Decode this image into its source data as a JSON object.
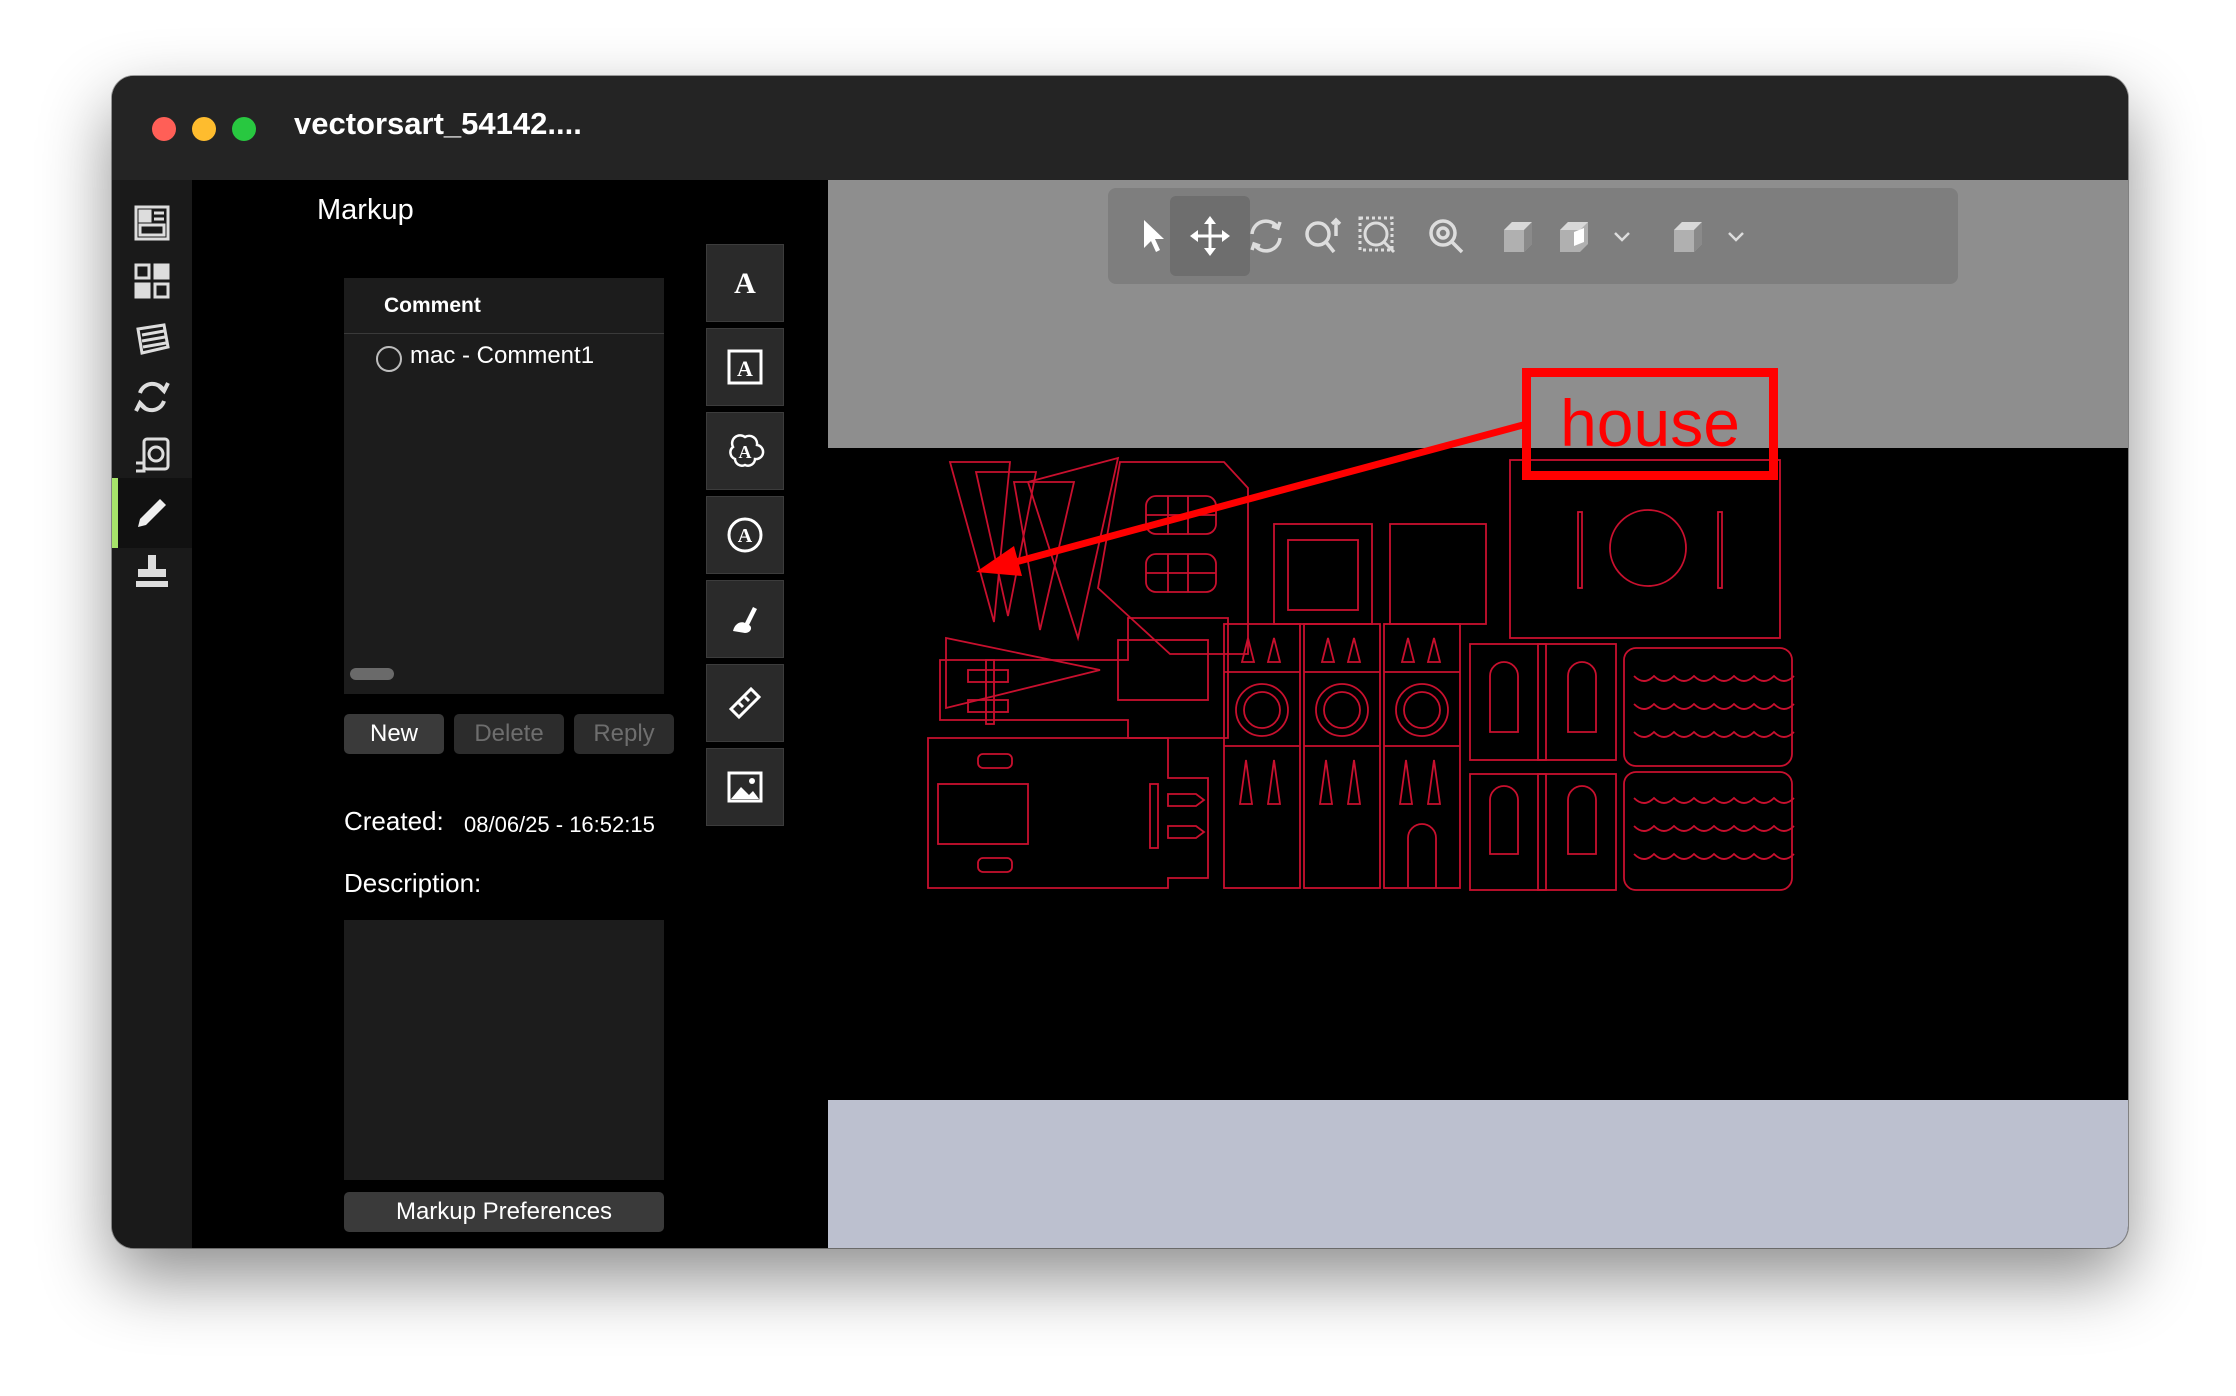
{
  "window": {
    "title": "vectorsart_54142...."
  },
  "rail": {
    "items": [
      {
        "name": "thumbnails",
        "icon": "dashboard-panel-icon"
      },
      {
        "name": "layers",
        "icon": "grid-squares-icon"
      },
      {
        "name": "sheets",
        "icon": "stacked-sheets-icon"
      },
      {
        "name": "sync",
        "icon": "sync-arrows-icon"
      },
      {
        "name": "measure",
        "icon": "measure-icon"
      },
      {
        "name": "markup",
        "icon": "pencil-icon",
        "active": true
      },
      {
        "name": "print",
        "icon": "stamp-icon"
      }
    ],
    "accent_color": "#a6e36a"
  },
  "markup": {
    "title": "Markup",
    "comment_header": "Comment",
    "comments": [
      {
        "label": "mac - Comment1"
      }
    ],
    "buttons": {
      "new": "New",
      "delete": "Delete",
      "reply": "Reply"
    },
    "created_label": "Created:",
    "created_value": "08/06/25 - 16:52:15",
    "description_label": "Description:",
    "preferences_button": "Markup Preferences"
  },
  "tools": [
    {
      "name": "text-tool",
      "glyph": "A"
    },
    {
      "name": "text-box-tool",
      "glyph": "A"
    },
    {
      "name": "cloud-text-tool",
      "glyph": "A"
    },
    {
      "name": "circle-text-tool",
      "glyph": "A"
    },
    {
      "name": "freehand-tool",
      "icon": "freehand-icon"
    },
    {
      "name": "ruler-tool",
      "icon": "ruler-icon"
    },
    {
      "name": "image-tool",
      "icon": "image-icon"
    }
  ],
  "viewer_toolbar": [
    {
      "name": "select",
      "icon": "cursor-icon"
    },
    {
      "name": "pan",
      "icon": "move-icon",
      "active": true
    },
    {
      "name": "rotate",
      "icon": "rotate-icon"
    },
    {
      "name": "zoom",
      "icon": "zoom-icon"
    },
    {
      "name": "zoom-window",
      "icon": "zoom-window-icon"
    },
    {
      "name": "zoom-fit",
      "icon": "zoom-fit-icon"
    },
    {
      "name": "view-box",
      "icon": "box-icon"
    },
    {
      "name": "section",
      "icon": "section-box-icon"
    },
    {
      "name": "render",
      "icon": "render-box-icon"
    }
  ],
  "annotation": {
    "label": "house",
    "color": "#ff0000"
  },
  "drawing": {
    "line_color": "#c8102e",
    "background": "#000000"
  }
}
